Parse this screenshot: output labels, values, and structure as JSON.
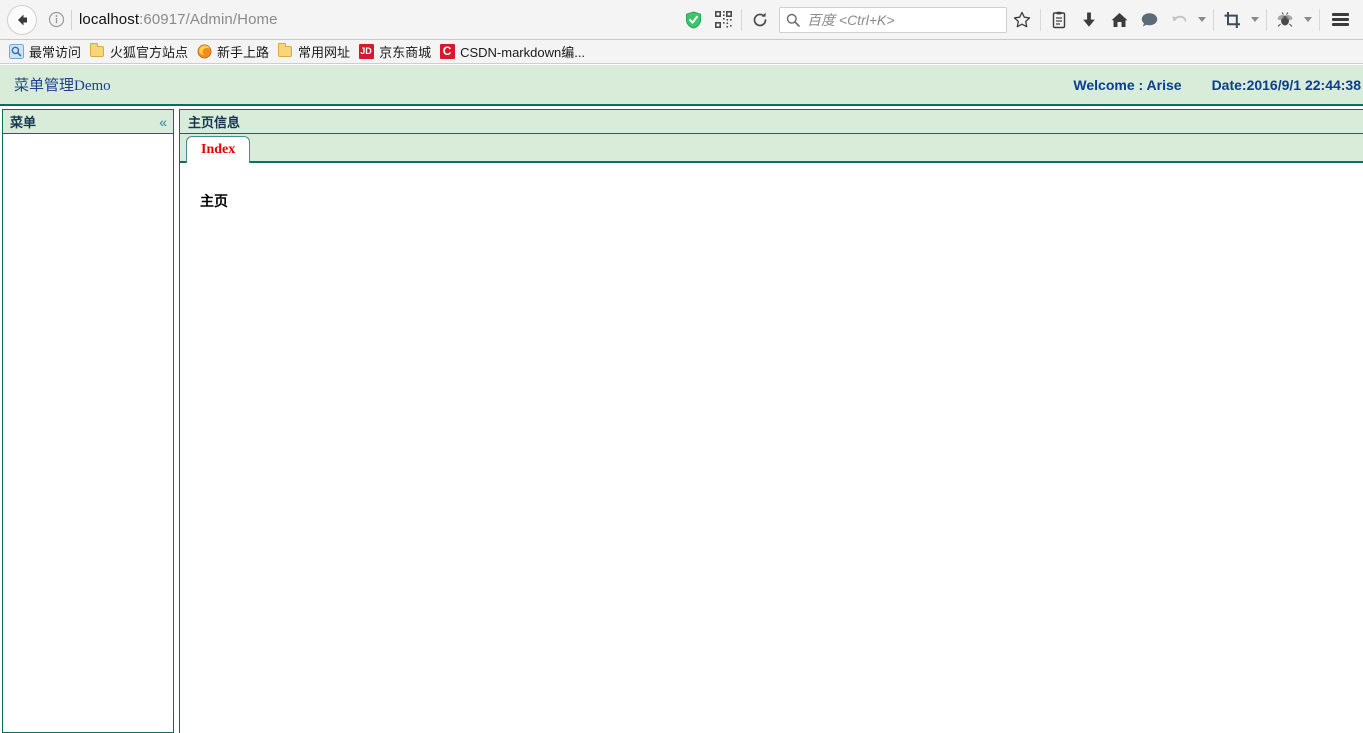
{
  "browser": {
    "back_button": "back-arrow",
    "info_icon": "info-circle-icon",
    "url": "localhost:60917/Admin/Home",
    "url_host": "localhost",
    "url_path": ":60917/Admin/Home",
    "shield_icon": "shield-check-icon",
    "qr_icon": "qr-code-icon",
    "reload_icon": "reload-icon",
    "search_placeholder": "百度 <Ctrl+K>",
    "search_icon": "search-icon",
    "bookmark_star_icon": "star-icon",
    "library_icon": "library-icon",
    "downloads_icon": "download-arrow-icon",
    "home_icon": "home-icon",
    "chat_icon": "chat-bubble-icon",
    "undo_icon": "undo-arrow-icon",
    "crop_icon": "crop-icon",
    "bug_icon": "bug-icon",
    "menu_icon": "hamburger-menu-icon"
  },
  "bookmarks": [
    {
      "label": "最常访问",
      "icon": "most-visited-icon"
    },
    {
      "label": "火狐官方站点",
      "icon": "folder-icon"
    },
    {
      "label": "新手上路",
      "icon": "firefox-icon"
    },
    {
      "label": "常用网址",
      "icon": "folder-icon"
    },
    {
      "label": "京东商城",
      "icon": "jd-icon"
    },
    {
      "label": "CSDN-markdown编...",
      "icon": "csdn-icon"
    }
  ],
  "app": {
    "title": "菜单管理Demo",
    "welcome": "Welcome : Arise",
    "date": "Date:2016/9/1 22:44:38",
    "colors": {
      "header_bg": "#d8ecd9",
      "border": "#0a6e5c",
      "title_color": "#1f3f8f",
      "tab_active_text": "#e60000"
    },
    "menu_panel": {
      "title": "菜单",
      "collapse_icon": "«"
    },
    "content_panel": {
      "title": "主页信息",
      "tabs": [
        {
          "label": "Index",
          "active": true
        }
      ],
      "body_text": "主页"
    }
  }
}
